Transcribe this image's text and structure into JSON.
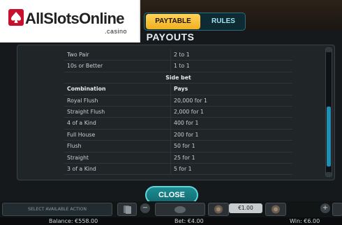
{
  "logo": {
    "text": "AllSlotsOnline",
    "suffix": ".casino"
  },
  "tabs": [
    {
      "label": "PAYTABLE",
      "active": true
    },
    {
      "label": "RULES",
      "active": false
    }
  ],
  "title": "PAYOUTS",
  "table": {
    "rows_top": [
      {
        "hand": "Two Pair",
        "pays": "2 to 1"
      },
      {
        "hand": "10s or Better",
        "pays": "1 to 1"
      }
    ],
    "section_label": "Side bet",
    "header": {
      "combination": "Combination",
      "pays": "Pays"
    },
    "rows": [
      {
        "hand": "Royal Flush",
        "pays": "20,000 for 1"
      },
      {
        "hand": "Straight Flush",
        "pays": "2,000 for 1"
      },
      {
        "hand": "4 of a Kind",
        "pays": "400 for 1"
      },
      {
        "hand": "Full House",
        "pays": "200 for 1"
      },
      {
        "hand": "Flush",
        "pays": "50 for 1"
      },
      {
        "hand": "Straight",
        "pays": "25 for 1"
      },
      {
        "hand": "3 of a Kind",
        "pays": "5 for 1"
      }
    ]
  },
  "close_label": "CLOSE",
  "bottom": {
    "action_label": "SELECT AVAILABLE ACTION",
    "bet_value": "€1.00",
    "minus": "−",
    "plus": "+"
  },
  "status": {
    "balance": "Balance: €558.00",
    "bet": "Bet: €4.00",
    "win": "Win: €6.00"
  },
  "colors": {
    "accent": "#f0b020",
    "teal": "#1c8e93",
    "scroll": "#1f8fb5"
  }
}
